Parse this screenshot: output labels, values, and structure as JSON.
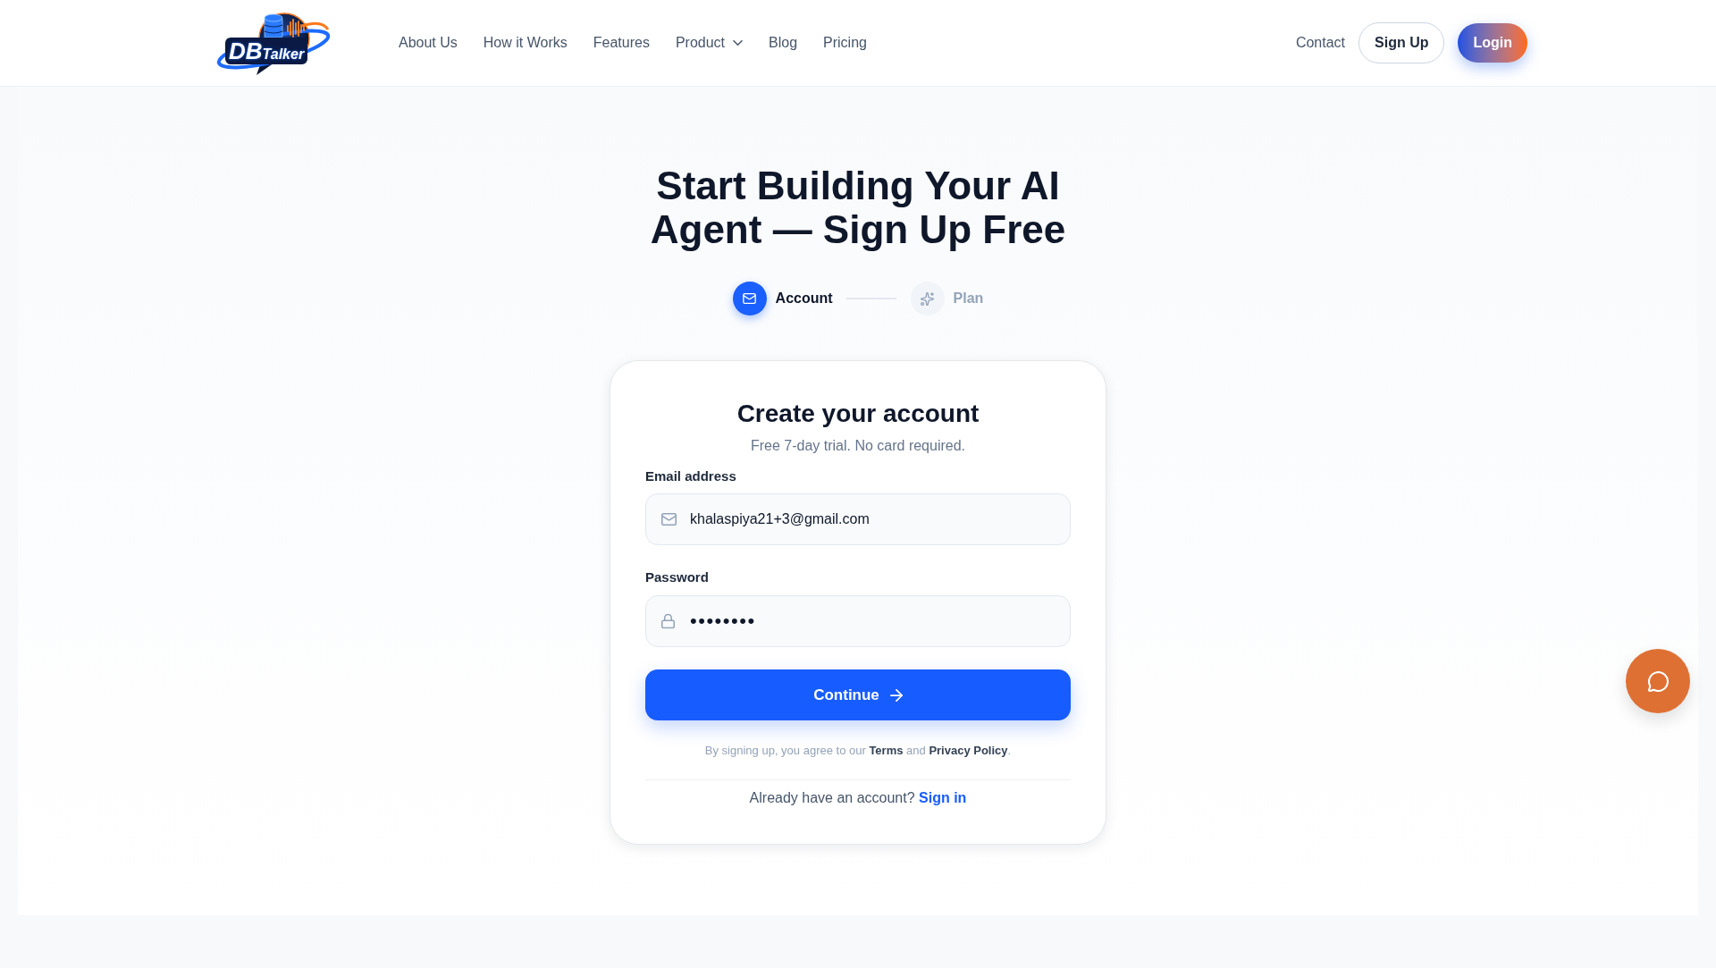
{
  "header": {
    "logo": {
      "mark": "DB",
      "name": "Talker"
    },
    "nav": [
      {
        "label": "About Us",
        "kind": "link"
      },
      {
        "label": "How it Works",
        "kind": "link"
      },
      {
        "label": "Features",
        "kind": "link"
      },
      {
        "label": "Product",
        "kind": "menu"
      },
      {
        "label": "Blog",
        "kind": "link"
      },
      {
        "label": "Pricing",
        "kind": "link"
      }
    ],
    "contact": "Contact",
    "sign_up": "Sign Up",
    "login": "Login"
  },
  "hero": {
    "title": "Start Building Your AI Agent — Sign Up Free",
    "steps": [
      {
        "label": "Account",
        "selected": true
      },
      {
        "label": "Plan",
        "selected": false
      }
    ]
  },
  "form": {
    "title": "Create your account",
    "subtitle": "Free 7-day trial. No card required.",
    "fields": [
      {
        "kind": "email",
        "label": "Email address",
        "value": "khalaspiya21+3@gmail.com"
      },
      {
        "kind": "password",
        "label": "Password",
        "value": "••••••••"
      }
    ],
    "submit": "Continue",
    "legal": [
      {
        "kind": "text",
        "text": "By signing up, you agree to our "
      },
      {
        "kind": "link",
        "text": "Terms"
      },
      {
        "kind": "text",
        "text": " and "
      },
      {
        "kind": "link",
        "text": "Privacy Policy"
      },
      {
        "kind": "text",
        "text": "."
      }
    ],
    "signin_prompt": {
      "text": "Already have an account?",
      "link": "Sign in"
    }
  }
}
